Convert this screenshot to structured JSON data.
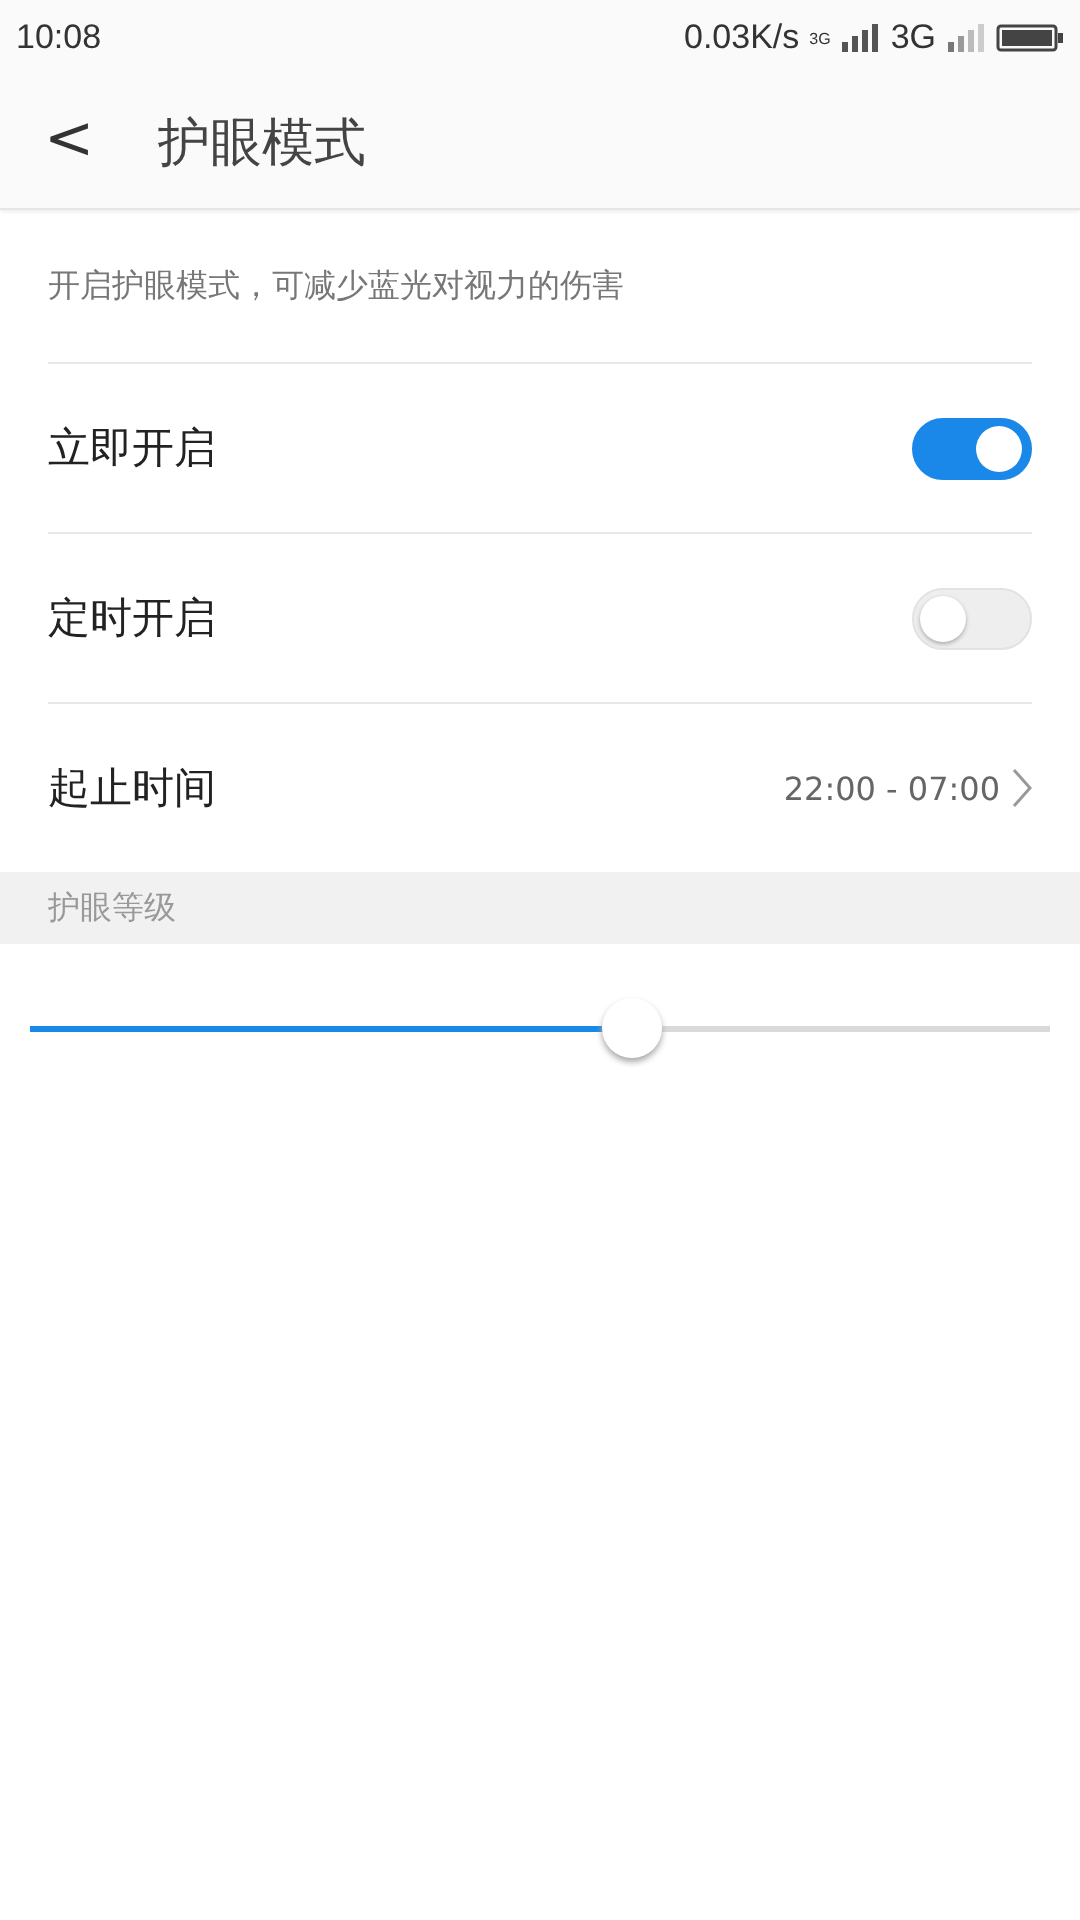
{
  "status_bar": {
    "time": "10:08",
    "speed": "0.03K/s",
    "network_small": "3G",
    "network": "3G"
  },
  "header": {
    "back": "<",
    "title": "护眼模式"
  },
  "description": "开启护眼模式，可减少蓝光对视力的伤害",
  "settings": [
    {
      "kind": "toggle",
      "label": "立即开启",
      "on": true
    },
    {
      "kind": "toggle",
      "label": "定时开启",
      "on": false
    },
    {
      "kind": "value",
      "label": "起止时间",
      "value": "22:00 - 07:00"
    }
  ],
  "level_section": {
    "title": "护眼等级",
    "level": 0.59
  }
}
